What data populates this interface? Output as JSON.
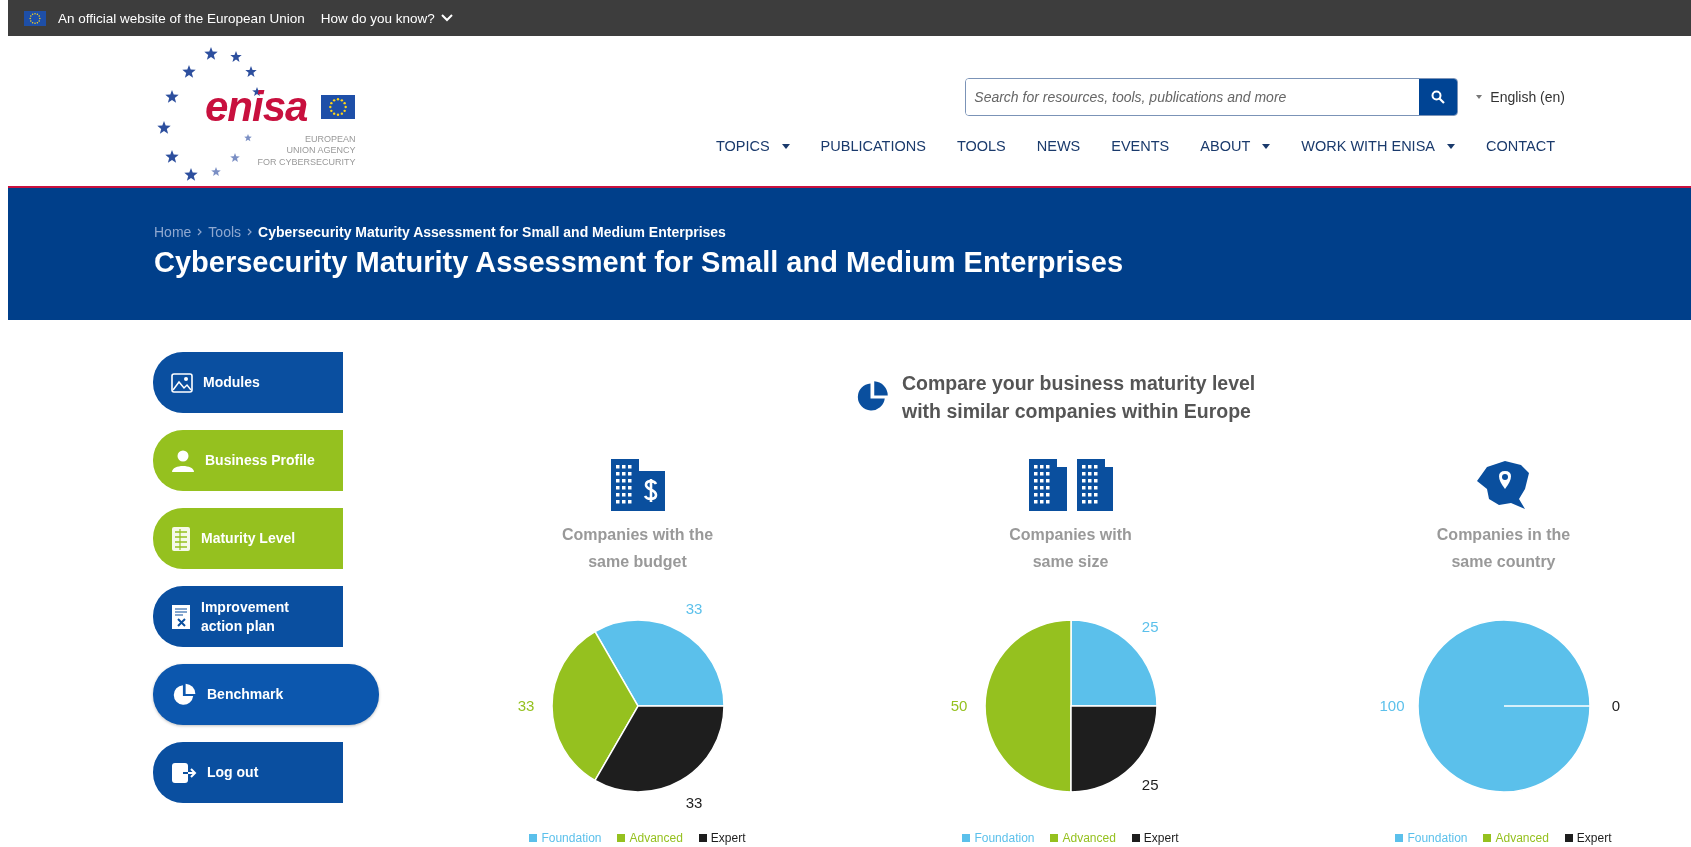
{
  "eu_banner": {
    "text": "An official website of the European Union",
    "link": "How do you know?"
  },
  "logo": {
    "wordmark": "enisa",
    "tagline": [
      "EUROPEAN",
      "UNION AGENCY",
      "FOR CYBERSECURITY"
    ]
  },
  "search": {
    "placeholder": "Search for resources, tools, publications and more"
  },
  "language": "English (en)",
  "nav": [
    {
      "label": "TOPICS",
      "has_menu": true
    },
    {
      "label": "PUBLICATIONS",
      "has_menu": false
    },
    {
      "label": "TOOLS",
      "has_menu": false
    },
    {
      "label": "NEWS",
      "has_menu": false
    },
    {
      "label": "EVENTS",
      "has_menu": false
    },
    {
      "label": "ABOUT",
      "has_menu": true
    },
    {
      "label": "WORK WITH ENISA",
      "has_menu": true
    },
    {
      "label": "CONTACT",
      "has_menu": false
    }
  ],
  "breadcrumb": [
    {
      "label": "Home",
      "current": false
    },
    {
      "label": "Tools",
      "current": false
    },
    {
      "label": "Cybersecurity Maturity Assessment for Small and Medium Enterprises",
      "current": true
    }
  ],
  "page_title": "Cybersecurity Maturity Assessment for Small and Medium Enterprises",
  "sidebar": [
    {
      "label": "Modules",
      "completed": false,
      "selected": false
    },
    {
      "label": "Business Profile",
      "completed": true,
      "selected": false
    },
    {
      "label": "Maturity Level",
      "completed": true,
      "selected": false
    },
    {
      "label": "Improvement action plan",
      "completed": false,
      "selected": false
    },
    {
      "label": "Benchmark",
      "completed": false,
      "selected": true
    },
    {
      "label": "Log out",
      "completed": false,
      "selected": false
    }
  ],
  "heading": "Compare your business maturity level with similar companies within Europe",
  "panels": [
    {
      "chart_data": {
        "type": "pie",
        "title": "Companies with the same budget",
        "categories": [
          "Foundation",
          "Advanced",
          "Expert"
        ],
        "values": [
          33,
          33,
          33
        ],
        "value_labels": [
          "33",
          "33",
          "33"
        ]
      },
      "legend": [
        {
          "color": "#5bc0eb"
        },
        {
          "color": "#95c11f"
        },
        {
          "color": "#1e1e1e"
        }
      ]
    },
    {
      "chart_data": {
        "type": "pie",
        "title": "Companies with same size",
        "categories": [
          "Foundation",
          "Advanced",
          "Expert"
        ],
        "values": [
          25,
          50,
          25
        ],
        "value_labels": [
          "25",
          "50",
          "25"
        ]
      },
      "legend": [
        {
          "color": "#5bc0eb"
        },
        {
          "color": "#95c11f"
        },
        {
          "color": "#1e1e1e"
        }
      ]
    },
    {
      "chart_data": {
        "type": "pie",
        "title": "Companies in the same country",
        "categories": [
          "Foundation",
          "Advanced",
          "Expert"
        ],
        "values": [
          100,
          0,
          0
        ],
        "value_labels": [
          "100",
          null,
          "0"
        ]
      },
      "legend": [
        {
          "color": "#5bc0eb"
        },
        {
          "color": "#95c11f"
        },
        {
          "color": "#1e1e1e"
        }
      ]
    }
  ]
}
